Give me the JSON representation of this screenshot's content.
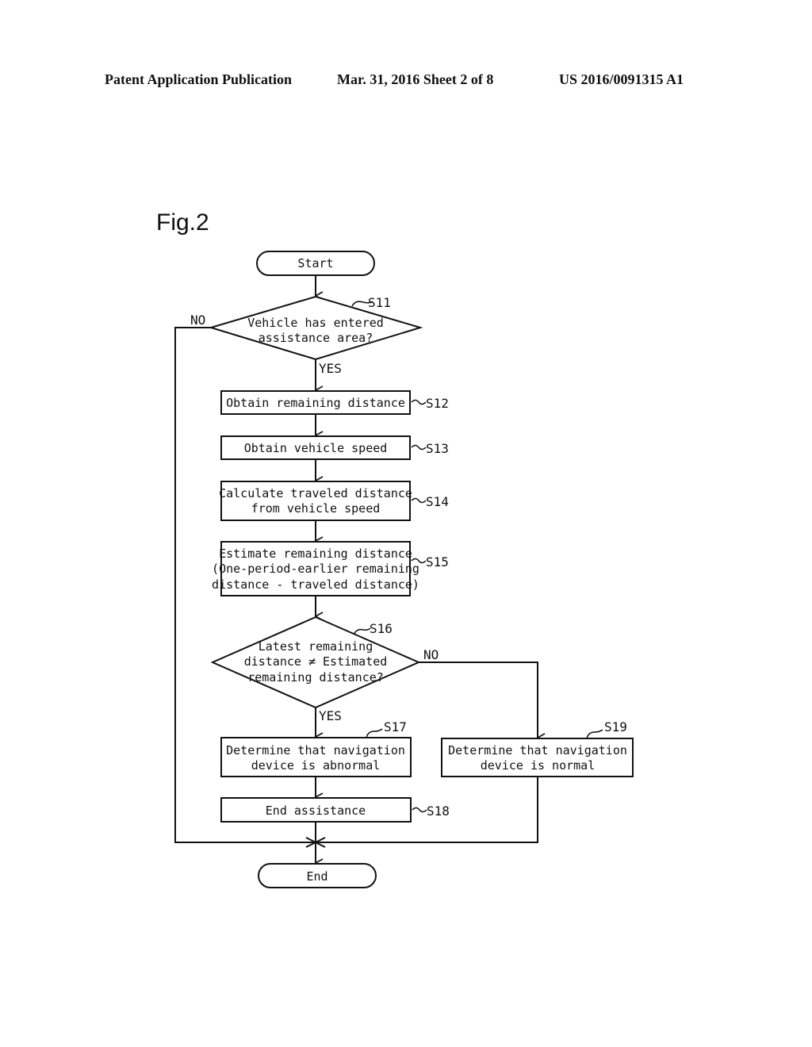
{
  "header": {
    "left": "Patent Application Publication",
    "middle": "Mar. 31, 2016  Sheet 2 of 8",
    "right": "US 2016/0091315 A1"
  },
  "figure": {
    "title": "Fig.2",
    "start": "Start",
    "end": "End",
    "steps": {
      "s11": {
        "id": "S11",
        "lines": [
          "Vehicle has entered",
          "assistance area?"
        ],
        "yes": "YES",
        "no": "NO"
      },
      "s12": {
        "id": "S12",
        "lines": [
          "Obtain remaining distance"
        ]
      },
      "s13": {
        "id": "S13",
        "lines": [
          "Obtain vehicle speed"
        ]
      },
      "s14": {
        "id": "S14",
        "lines": [
          "Calculate traveled distance",
          "from vehicle speed"
        ]
      },
      "s15": {
        "id": "S15",
        "lines": [
          "Estimate remaining distance",
          "(One-period-earlier remaining",
          "distance - traveled distance)"
        ]
      },
      "s16": {
        "id": "S16",
        "lines": [
          "Latest remaining",
          "distance ≠ Estimated",
          "remaining distance?"
        ],
        "yes": "YES",
        "no": "NO"
      },
      "s17": {
        "id": "S17",
        "lines": [
          "Determine that navigation",
          "device is abnormal"
        ]
      },
      "s18": {
        "id": "S18",
        "lines": [
          "End assistance"
        ]
      },
      "s19": {
        "id": "S19",
        "lines": [
          "Determine that navigation",
          "device is normal"
        ]
      }
    }
  }
}
